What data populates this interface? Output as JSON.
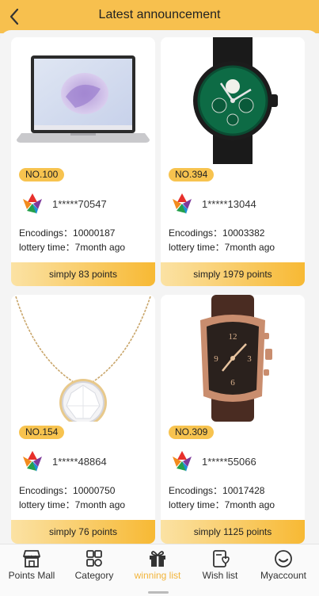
{
  "header": {
    "title": "Latest announcement"
  },
  "cards": [
    {
      "badge": "NO.100",
      "user": "1*****70547",
      "encodings": "Encodings：10000187",
      "lottery": "lottery time：7month ago",
      "points": "simply 83 points",
      "product": "laptop"
    },
    {
      "badge": "NO.394",
      "user": "1*****13044",
      "encodings": "Encodings：10003382",
      "lottery": "lottery time：7month ago",
      "points": "simply 1979 points",
      "product": "watch"
    },
    {
      "badge": "NO.154",
      "user": "1*****48864",
      "encodings": "Encodings：10000750",
      "lottery": "lottery time：7month ago",
      "points": "simply 76 points",
      "product": "necklace"
    },
    {
      "badge": "NO.309",
      "user": "1*****55066",
      "encodings": "Encodings：10017428",
      "lottery": "lottery time：7month ago",
      "points": "simply 1125 points",
      "product": "watch"
    }
  ],
  "tabs": [
    {
      "label": "Points Mall",
      "icon": "shop-icon"
    },
    {
      "label": "Category",
      "icon": "grid-icon"
    },
    {
      "label": "winning list",
      "icon": "gift-icon",
      "active": true
    },
    {
      "label": "Wish list",
      "icon": "wishlist-icon"
    },
    {
      "label": "Myaccount",
      "icon": "smile-icon"
    }
  ],
  "colors": {
    "accent": "#f7c04e",
    "active_tab": "#f2b43a"
  }
}
